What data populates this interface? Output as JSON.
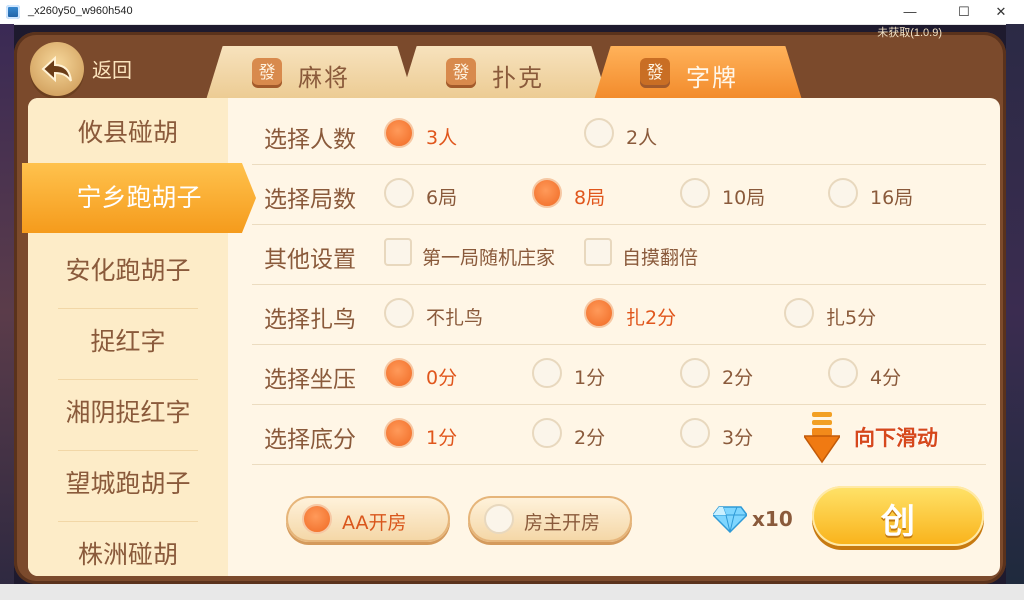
{
  "window": {
    "title": "_x260y50_w960h540",
    "minimize": "—",
    "maximize": "☐",
    "close": "✕"
  },
  "version": "未获取(1.0.9)",
  "back": {
    "label": "返回",
    "icon": "back-arrow-icon"
  },
  "tabs": [
    {
      "tile": "發",
      "label": "麻将"
    },
    {
      "tile": "發",
      "label": "扑克"
    },
    {
      "tile": "發",
      "label": "字牌",
      "active": true
    }
  ],
  "sidebar": {
    "items": [
      {
        "label": "攸县碰胡"
      },
      {
        "label": "宁乡跑胡子",
        "active": true
      },
      {
        "label": "安化跑胡子"
      },
      {
        "label": "捉红字"
      },
      {
        "label": "湘阴捉红字"
      },
      {
        "label": "望城跑胡子"
      },
      {
        "label": "株洲碰胡"
      }
    ]
  },
  "settings": {
    "players": {
      "label": "选择人数",
      "options": [
        "3人",
        "2人"
      ],
      "selected": "3人"
    },
    "rounds": {
      "label": "选择局数",
      "options": [
        "6局",
        "8局",
        "10局",
        "16局"
      ],
      "selected": "8局"
    },
    "other": {
      "label": "其他设置",
      "options": [
        "第一局随机庄家",
        "自摸翻倍"
      ]
    },
    "bird": {
      "label": "选择扎鸟",
      "options": [
        "不扎鸟",
        "扎2分",
        "扎5分"
      ],
      "selected": "扎2分"
    },
    "press": {
      "label": "选择坐压",
      "options": [
        "0分",
        "1分",
        "2分",
        "4分"
      ],
      "selected": "0分"
    },
    "base": {
      "label": "选择底分",
      "options": [
        "1分",
        "2分",
        "3分"
      ],
      "selected": "1分"
    }
  },
  "scroll_hint": "向下滑动",
  "room_type": {
    "options": [
      "AA开房",
      "房主开房"
    ],
    "selected": "AA开房"
  },
  "cost": {
    "icon": "diamond-icon",
    "count": "x10"
  },
  "create_button": {
    "label": "创"
  },
  "colors": {
    "accent": "#f28a2a",
    "selected_text": "#e0561c",
    "text": "#8a5a3b"
  }
}
